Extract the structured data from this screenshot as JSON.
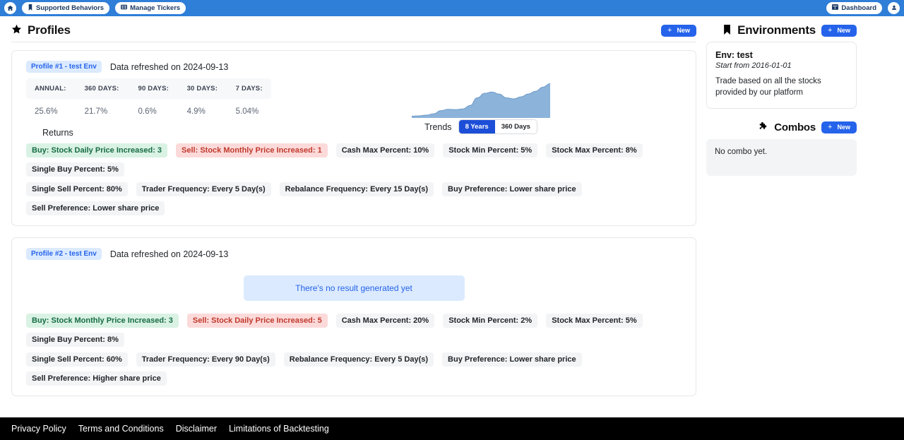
{
  "topbar": {
    "home_icon": "home-icon",
    "links": [
      {
        "icon": "bookmark-icon",
        "label": "Supported Behaviors"
      },
      {
        "icon": "ticket-grid-icon",
        "label": "Manage Tickers"
      }
    ],
    "dashboard": {
      "icon": "dashboard-grid-icon",
      "label": "Dashboard"
    },
    "account_icon": "account-circle-icon",
    "bar_color": "#2f7ed8"
  },
  "profiles_section": {
    "icon": "star-icon",
    "title": "Profiles",
    "new_button": {
      "plus": "+",
      "label": "New"
    }
  },
  "environments_section": {
    "icon": "bookmark-icon",
    "title": "Environments",
    "new_button": {
      "plus": "+",
      "label": "New"
    }
  },
  "combos_section": {
    "icon": "puzzle-icon",
    "title": "Combos",
    "new_button": {
      "plus": "+",
      "label": "New"
    },
    "empty_text": "No combo yet."
  },
  "environment": {
    "name": "Env: test",
    "start": "Start from 2016-01-01",
    "description": "Trade based on all the stocks provided by our platform"
  },
  "returns_header": "Returns",
  "trends": {
    "label": "Trends",
    "options": [
      "8 Years",
      "360 Days"
    ],
    "selected": "8 Years"
  },
  "profiles": [
    {
      "badge": "Profile #1 - test Env",
      "refreshed": "Data refreshed on 2024-09-13",
      "has_results": true,
      "returns_columns": [
        "ANNUAL:",
        "360 DAYS:",
        "90 DAYS:",
        "30 DAYS:",
        "7 DAYS:"
      ],
      "returns_values": [
        "25.6%",
        "21.7%",
        "0.6%",
        "4.9%",
        "5.04%"
      ],
      "tags_row1": [
        {
          "text": "Buy: Stock Daily Price Increased: 3",
          "kind": "buy"
        },
        {
          "text": "Sell: Stock Monthly Price Increased: 1",
          "kind": "sell"
        },
        {
          "text": "Cash Max Percent: 10%",
          "kind": "plain"
        },
        {
          "text": "Stock Min Percent: 5%",
          "kind": "plain"
        },
        {
          "text": "Stock Max Percent: 8%",
          "kind": "plain"
        },
        {
          "text": "Single Buy Percent: 5%",
          "kind": "plain"
        }
      ],
      "tags_row2": [
        {
          "text": "Single Sell Percent: 80%",
          "kind": "plain"
        },
        {
          "text": "Trader Frequency: Every 5 Day(s)",
          "kind": "plain"
        },
        {
          "text": "Rebalance Frequency: Every 15 Day(s)",
          "kind": "plain"
        },
        {
          "text": "Buy Preference: Lower share price",
          "kind": "plain"
        },
        {
          "text": "Sell Preference: Lower share price",
          "kind": "plain"
        }
      ]
    },
    {
      "badge": "Profile #2 - test Env",
      "refreshed": "Data refreshed on 2024-09-13",
      "has_results": false,
      "empty_message": "There's no result generated yet",
      "tags_row1": [
        {
          "text": "Buy: Stock Monthly Price Increased: 3",
          "kind": "buy"
        },
        {
          "text": "Sell: Stock Daily Price Increased: 5",
          "kind": "sell"
        },
        {
          "text": "Cash Max Percent: 20%",
          "kind": "plain"
        },
        {
          "text": "Stock Min Percent: 2%",
          "kind": "plain"
        },
        {
          "text": "Stock Max Percent: 5%",
          "kind": "plain"
        },
        {
          "text": "Single Buy Percent: 8%",
          "kind": "plain"
        }
      ],
      "tags_row2": [
        {
          "text": "Single Sell Percent: 60%",
          "kind": "plain"
        },
        {
          "text": "Trader Frequency: Every 90 Day(s)",
          "kind": "plain"
        },
        {
          "text": "Rebalance Frequency: Every 5 Day(s)",
          "kind": "plain"
        },
        {
          "text": "Buy Preference: Lower share price",
          "kind": "plain"
        },
        {
          "text": "Sell Preference: Higher share price",
          "kind": "plain"
        }
      ]
    }
  ],
  "chart_data": {
    "type": "area",
    "title": "",
    "xlabel": "",
    "ylabel": "",
    "series": [
      {
        "name": "Trend (8 Years)",
        "values": [
          2,
          3,
          5,
          9,
          18,
          22,
          21,
          23,
          33,
          55,
          68,
          72,
          66,
          55,
          52,
          58,
          66,
          74,
          86,
          96
        ]
      }
    ],
    "x": [
      0,
      1,
      2,
      3,
      4,
      5,
      6,
      7,
      8,
      9,
      10,
      11,
      12,
      13,
      14,
      15,
      16,
      17,
      18,
      19
    ],
    "ylim": [
      0,
      100
    ],
    "grid": false,
    "legend": "none",
    "fill_color": "#8cb3d9",
    "line_color": "#6f9bc9"
  },
  "footer_links": [
    "Privacy Policy",
    "Terms and Conditions",
    "Disclaimer",
    "Limitations of Backtesting"
  ]
}
